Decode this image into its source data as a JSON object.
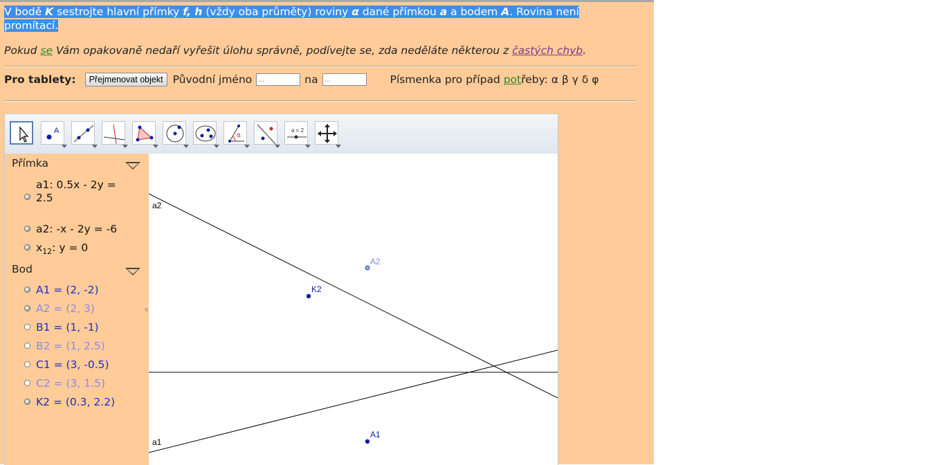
{
  "task": {
    "part1": "V bodě ",
    "K": "K",
    "part2": " sestrojte hlavní přímky ",
    "fh": "f, h",
    "part3": " (vždy oba průměty) roviny ",
    "alpha": "α",
    "part4": " dané přímkou ",
    "a": "a",
    "part5": " a bodem ",
    "A": "A",
    "part6": ". Rovina není",
    "part7": "promítací."
  },
  "hint": {
    "pre": "Pokud ",
    "link1": "se",
    "mid": " Vám opakovaně nedaří vyřešit úlohu správně, podívejte se, zda neděláte některou z ",
    "link2": "častých chyb",
    "post": "."
  },
  "tablet": {
    "label": "Pro tablety:",
    "button": "Přejmenovat objekt",
    "orig_label": "Původní jméno",
    "orig_placeholder": "...",
    "to_label": "na",
    "to_placeholder": "...",
    "letters_pre": "Písmenka pro případ ",
    "letters_link": "pot",
    "letters_post": "řeby: α β γ δ φ"
  },
  "toolbar": {
    "tools": [
      "move-tool",
      "point-tool",
      "line-tool",
      "perpendicular-tool",
      "polygon-tool",
      "circle-tool",
      "conic-tool",
      "angle-tool",
      "reflect-tool",
      "slider-tool",
      "move-view-tool"
    ]
  },
  "algebra": {
    "group_line": "Přímka",
    "a1_line1": "a1: 0.5x - 2y =",
    "a1_line2": "2.5",
    "a2": "a2: -x - 2y = -6",
    "x12_pre": "x",
    "x12_sub": "12",
    "x12_post": ": y = 0",
    "group_point": "Bod",
    "points": [
      {
        "text": "A1 = (2, -2)",
        "visible": true
      },
      {
        "text": "A2 = (2, 3)",
        "visible": true
      },
      {
        "text": "B1 = (1, -1)",
        "visible": false
      },
      {
        "text": "B2 = (1, 2.5)",
        "visible": false
      },
      {
        "text": "C1 = (3, -0.5)",
        "visible": false
      },
      {
        "text": "C2 = (3, 1.5)",
        "visible": false
      },
      {
        "text": "K2 = (0.3, 2.2)",
        "visible": true
      }
    ]
  },
  "graphics": {
    "labels": {
      "a2": "a2",
      "a1": "a1",
      "A2": "A2",
      "K2": "K2",
      "A1": "A1"
    },
    "colors": {
      "point_dark": "#0a1aa8",
      "point_light": "#7f8ad8",
      "line": "#000000"
    }
  }
}
